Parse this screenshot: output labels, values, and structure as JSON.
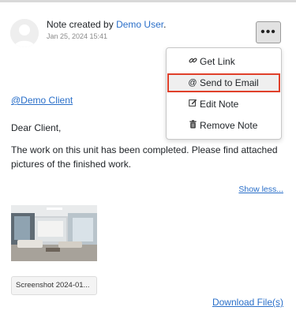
{
  "note": {
    "created_prefix": "Note created by ",
    "author": "Demo User",
    "created_suffix": ".",
    "timestamp": "Jan 25, 2024 15:41",
    "actions_icon": "ellipsis-horizontal-icon",
    "actions_label": "•••"
  },
  "menu": {
    "items": [
      {
        "label": "Get Link",
        "icon": "link-icon",
        "glyph": "🔗"
      },
      {
        "label": "Send to Email",
        "icon": "at-icon",
        "glyph": "@",
        "highlighted": true
      },
      {
        "label": "Edit Note",
        "icon": "edit-icon",
        "glyph": "✎"
      },
      {
        "label": "Remove Note",
        "icon": "trash-icon",
        "glyph": "🗑"
      }
    ]
  },
  "content": {
    "mention": "@Demo Client",
    "greeting": "Dear Client,",
    "body": "The work on this unit has been completed. Please find attached pictures of the finished work.",
    "show_less": "Show less..."
  },
  "attachment": {
    "file_name": "Screenshot 2024-01...",
    "download_label": "Download File(s)"
  },
  "colors": {
    "link": "#2a6fc9",
    "highlight_border": "#e0402a"
  }
}
